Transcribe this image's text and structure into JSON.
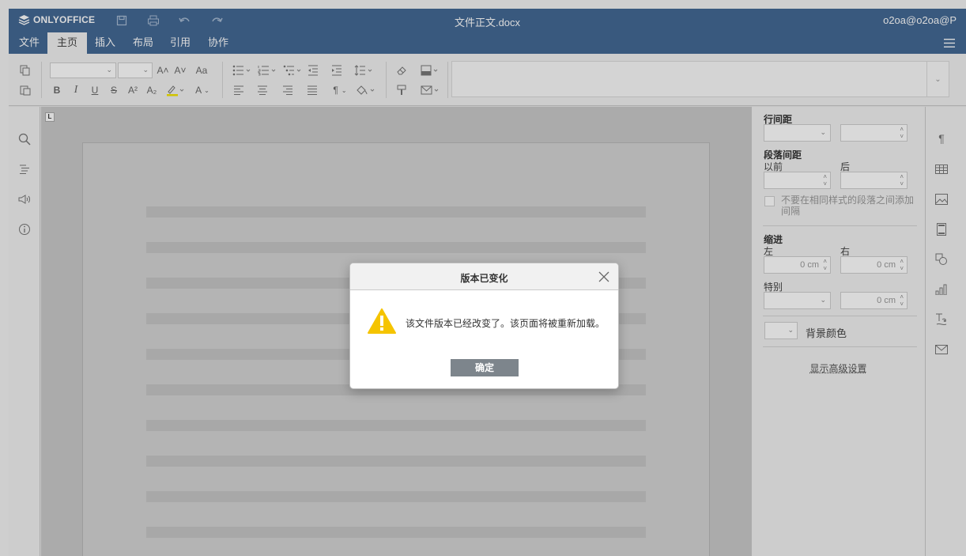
{
  "app": {
    "logo_text": "ONLYOFFICE",
    "document_title": "文件正文.docx",
    "user": "o2oa@o2oa@P"
  },
  "tabs": [
    "文件",
    "主页",
    "插入",
    "布局",
    "引用",
    "协作"
  ],
  "active_tab": "主页",
  "toolbar": {
    "icons_row1": [
      "copy-icon",
      "font-name-combo",
      "font-size-combo",
      "increase-font-icon",
      "decrease-font-icon",
      "change-case-icon",
      "bullets-icon",
      "numbering-icon",
      "multilevel-icon",
      "decrease-indent-icon",
      "increase-indent-icon",
      "line-spacing-icon",
      "clear-style-icon",
      "shading-icon"
    ],
    "icons_row2": [
      "paste-icon",
      "bold-icon",
      "italic-icon",
      "underline-icon",
      "strikeout-icon",
      "superscript-icon",
      "subscript-icon",
      "highlight-icon",
      "font-color-icon",
      "align-left-icon",
      "align-center-icon",
      "align-right-icon",
      "justify-icon",
      "nonprinting-icon",
      "paragraph-color-icon",
      "copy-style-icon",
      "mail-merge-icon"
    ],
    "glyphs": {
      "bold": "B",
      "italic": "I",
      "underline": "U",
      "strike": "S",
      "superscript": "A²",
      "subscript": "A₂",
      "font_color": "A",
      "increase_font": "A˄",
      "decrease_font": "A˅",
      "change_case": "Aa",
      "pilcrow": "¶"
    }
  },
  "right_panel": {
    "line_spacing_label": "行间距",
    "paragraph_spacing_label": "段落间距",
    "before_label": "以前",
    "after_label": "后",
    "dont_add_interval_label": "不要在相同样式的段落之间添加间隔",
    "indent_label": "缩进",
    "left_label": "左",
    "right_label": "右",
    "special_label": "特别",
    "indent_left_value": "0 cm",
    "indent_right_value": "0 cm",
    "special_value": "0 cm",
    "background_color_label": "背景颜色",
    "advanced_settings_link": "显示高级设置"
  },
  "right_bar_icons": [
    "paragraph-settings-icon",
    "table-settings-icon",
    "image-settings-icon",
    "header-footer-icon",
    "shape-settings-icon",
    "chart-settings-icon",
    "textart-settings-icon",
    "mail-merge-settings-icon"
  ],
  "left_bar_icons": [
    "search-icon",
    "navigation-icon",
    "feedback-icon",
    "about-icon"
  ],
  "dialog": {
    "title": "版本已变化",
    "message": "该文件版本已经改变了。该页面将被重新加载。",
    "ok_label": "确定"
  },
  "colors": {
    "header": "#446995",
    "toolbar": "#f1f1f1",
    "dialog_button": "#7d858c",
    "warning": "#f5c400"
  }
}
